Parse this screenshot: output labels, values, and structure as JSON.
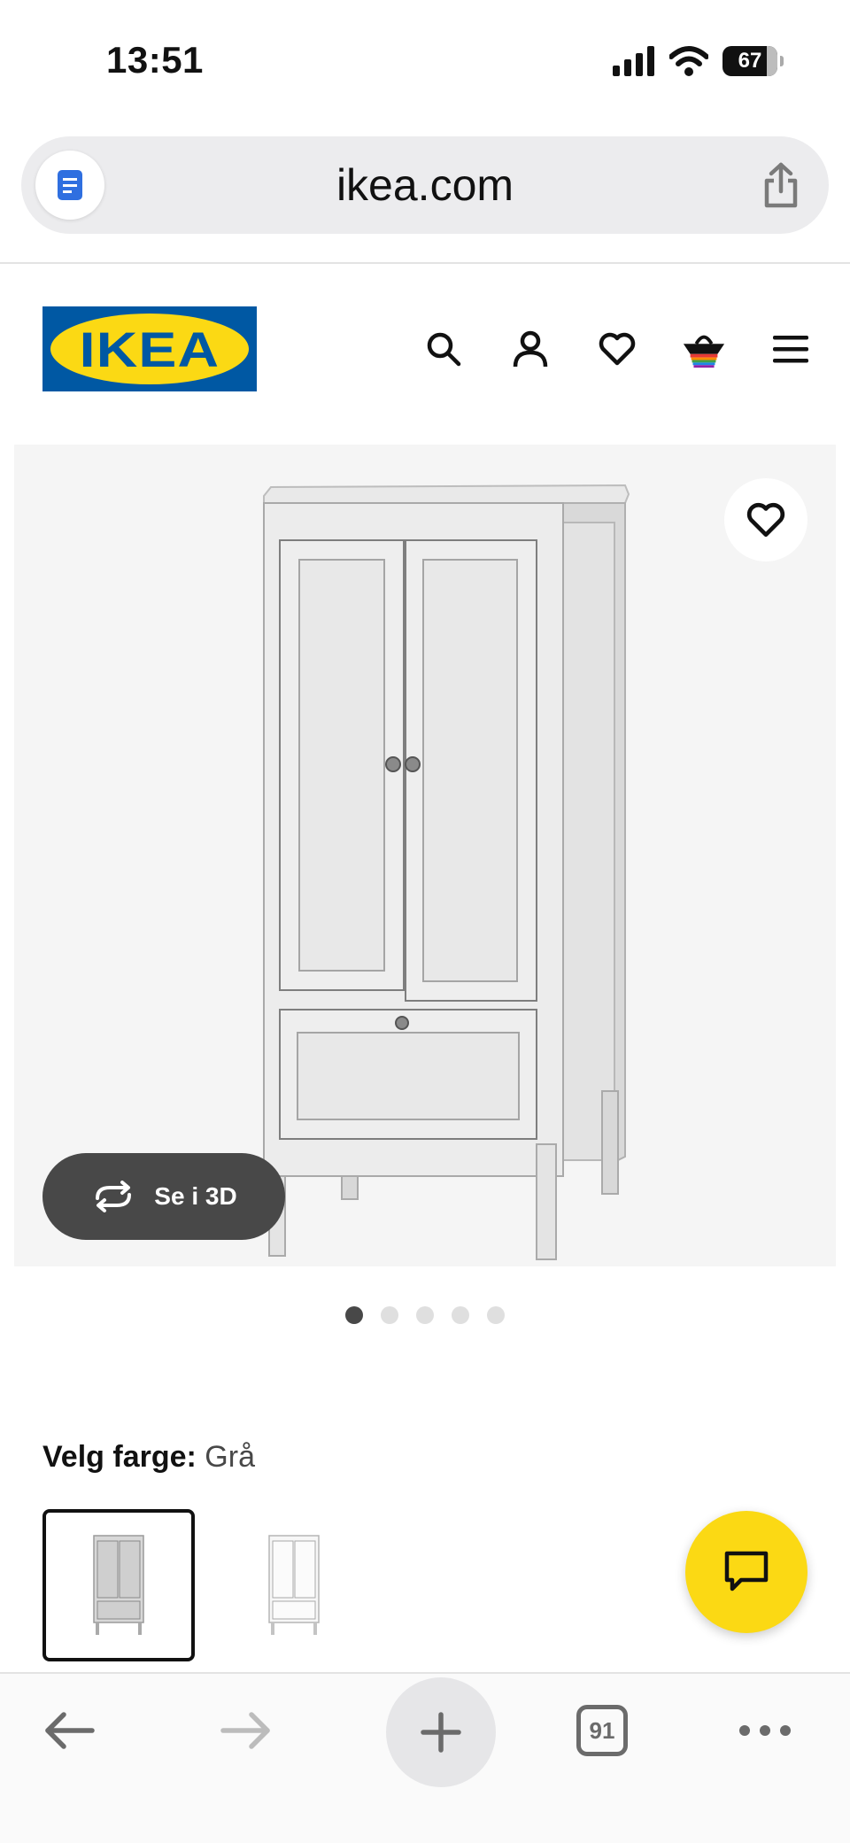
{
  "status_bar": {
    "time": "13:51",
    "battery": "67"
  },
  "browser": {
    "url": "ikea.com",
    "tabs_count": "91"
  },
  "site": {
    "brand": "IKEA"
  },
  "product": {
    "view_3d_label": "Se i 3D",
    "image_count": 5,
    "active_image": 1,
    "color_prompt": "Velg farge:",
    "color_value": "Grå",
    "swatches": [
      "grey wardrobe",
      "white wardrobe"
    ]
  },
  "colors": {
    "ikea_blue": "#0058a3",
    "ikea_yellow": "#fbd914",
    "pill_dark": "#484848"
  },
  "icons": {
    "header": [
      "search-icon",
      "account-icon",
      "heart-icon",
      "basket-icon",
      "menu-icon"
    ],
    "toolbar": [
      "back-arrow-icon",
      "forward-arrow-icon",
      "plus-icon",
      "tabs-icon",
      "more-icon"
    ]
  }
}
